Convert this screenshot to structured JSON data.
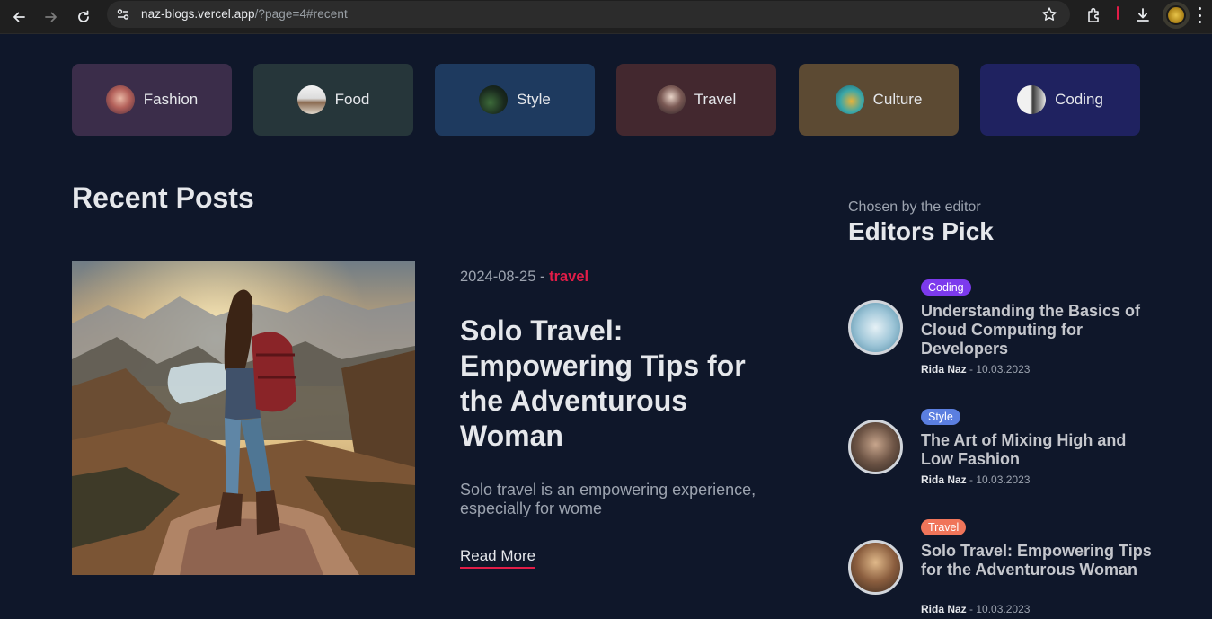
{
  "browser": {
    "url_host": "naz-blogs.vercel.app",
    "url_rest": "/?page=4#recent"
  },
  "categories": [
    {
      "label": "Fashion",
      "bg": "#3b2d4a"
    },
    {
      "label": "Food",
      "bg": "#26363a"
    },
    {
      "label": "Style",
      "bg": "#1e3a5f"
    },
    {
      "label": "Travel",
      "bg": "#43282f"
    },
    {
      "label": "Culture",
      "bg": "#5c4a33"
    },
    {
      "label": "Coding",
      "bg": "#1f2260"
    }
  ],
  "recent": {
    "heading": "Recent Posts",
    "post": {
      "date": "2024-08-25",
      "separator": " - ",
      "category": "travel",
      "title": "Solo Travel: Empowering Tips for the Adventurous Woman",
      "description": "Solo travel is an empowering experience, especially for wome",
      "read_more": "Read More"
    }
  },
  "editors_pick": {
    "subtitle": "Chosen by the editor",
    "title": "Editors Pick",
    "items": [
      {
        "badge": "Coding",
        "badge_color": "#7c3aed",
        "title": "Understanding the Basics of Cloud Computing for Developers",
        "author": "Rida Naz",
        "date": " - 10.03.2023"
      },
      {
        "badge": "Style",
        "badge_color": "#5b7fe0",
        "title": "The Art of Mixing High and Low Fashion",
        "author": "Rida Naz",
        "date": " - 10.03.2023"
      },
      {
        "badge": "Travel",
        "badge_color": "#f0755a",
        "title": "Solo Travel: Empowering Tips for the Adventurous Woman",
        "author": "Rida Naz",
        "date": " - 10.03.2023"
      }
    ]
  }
}
